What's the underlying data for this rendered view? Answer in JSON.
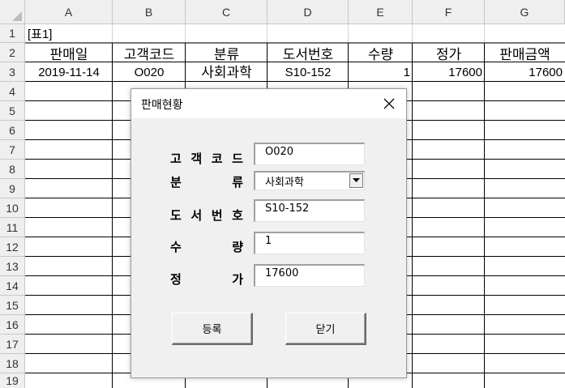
{
  "columns": [
    "A",
    "B",
    "C",
    "D",
    "E",
    "F",
    "G"
  ],
  "rows": [
    "1",
    "2",
    "3",
    "4",
    "5",
    "6",
    "7",
    "8",
    "9",
    "10",
    "11",
    "12",
    "13",
    "14",
    "15",
    "16",
    "17",
    "18",
    "19"
  ],
  "sheet": {
    "a1": "[표1]",
    "headers": [
      "판매일",
      "고객코드",
      "분류",
      "도서번호",
      "수량",
      "정가",
      "판매금액"
    ],
    "record": {
      "date": "2019-11-14",
      "customer_code": "O020",
      "category": "사회과학",
      "book_no": "S10-152",
      "qty": "1",
      "price": "17600",
      "amount": "17600"
    }
  },
  "dialog": {
    "title": "판매현황",
    "labels": {
      "customer_code": [
        "고",
        "객",
        "코",
        "드"
      ],
      "category": [
        "분",
        "류"
      ],
      "book_no": [
        "도",
        "서",
        "번",
        "호"
      ],
      "qty": [
        "수",
        "량"
      ],
      "price": [
        "정",
        "가"
      ]
    },
    "fields": {
      "customer_code": "O020",
      "category": "사회과학",
      "book_no": "S10-152",
      "qty": "1",
      "price": "17600"
    },
    "buttons": {
      "register": "등록",
      "close": "닫기"
    }
  }
}
